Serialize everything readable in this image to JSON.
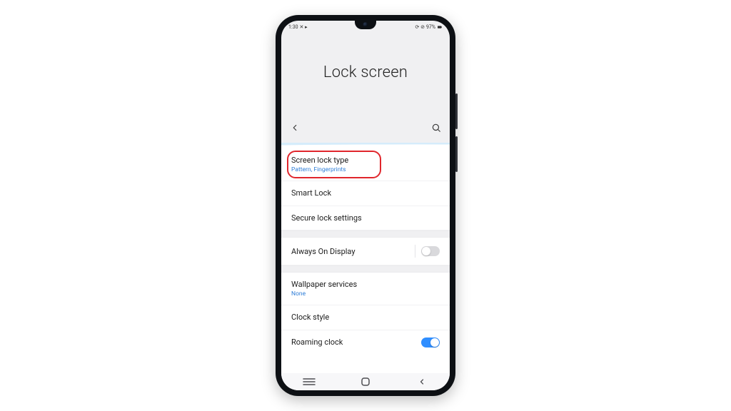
{
  "status": {
    "time": "1:30",
    "left_icons": "✕ ▸",
    "right_icons": "⟳ ⊘",
    "battery": "97%"
  },
  "header": {
    "title": "Lock screen"
  },
  "groups": [
    {
      "items": [
        {
          "title": "Screen lock type",
          "subtitle": "Pattern, Fingerprints",
          "highlighted": true
        },
        {
          "title": "Smart Lock"
        },
        {
          "title": "Secure lock settings"
        }
      ]
    },
    {
      "items": [
        {
          "title": "Always On Display",
          "toggle": "off"
        }
      ]
    },
    {
      "items": [
        {
          "title": "Wallpaper services",
          "subtitle": "None"
        },
        {
          "title": "Clock style"
        },
        {
          "title": "Roaming clock",
          "toggle": "on"
        }
      ]
    }
  ]
}
